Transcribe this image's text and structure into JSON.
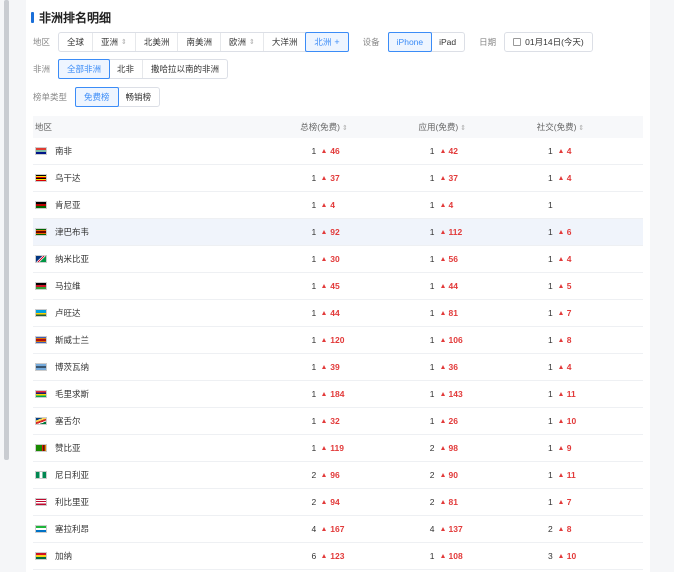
{
  "page_title": "非洲排名明细",
  "filters": {
    "region": {
      "label": "地区",
      "options": [
        "全球",
        "亚洲",
        "北美洲",
        "南美洲",
        "欧洲",
        "大洋洲",
        "北洲"
      ],
      "active": "北洲"
    },
    "device": {
      "label": "设备",
      "options": [
        "iPhone",
        "iPad"
      ],
      "active": "iPhone"
    },
    "date": {
      "label": "日期",
      "value": "01月14日(今天)"
    },
    "africa": {
      "label": "非洲",
      "options": [
        "全部非洲",
        "北非",
        "撒哈拉以南的非洲"
      ],
      "active": "全部非洲"
    },
    "list_type": {
      "label": "榜单类型",
      "options": [
        "免费榜",
        "畅销榜"
      ],
      "active": "免费榜"
    }
  },
  "table": {
    "headers": {
      "region": "地区",
      "overall": "总榜(免费)",
      "apps": "应用(免费)",
      "social": "社交(免费)"
    },
    "rows": [
      {
        "country": "南非",
        "flag": "za",
        "overall": {
          "rank": "1",
          "change": "46"
        },
        "apps": {
          "rank": "1",
          "change": "42"
        },
        "social": {
          "rank": "1",
          "change": "4"
        }
      },
      {
        "country": "乌干达",
        "flag": "ug",
        "overall": {
          "rank": "1",
          "change": "37"
        },
        "apps": {
          "rank": "1",
          "change": "37"
        },
        "social": {
          "rank": "1",
          "change": "4"
        }
      },
      {
        "country": "肯尼亚",
        "flag": "ke",
        "overall": {
          "rank": "1",
          "change": "4"
        },
        "apps": {
          "rank": "1",
          "change": "4"
        },
        "social": {
          "rank": "1",
          "change": ""
        }
      },
      {
        "country": "津巴布韦",
        "flag": "zw",
        "overall": {
          "rank": "1",
          "change": "92"
        },
        "apps": {
          "rank": "1",
          "change": "112"
        },
        "social": {
          "rank": "1",
          "change": "6"
        }
      },
      {
        "country": "纳米比亚",
        "flag": "na",
        "overall": {
          "rank": "1",
          "change": "30"
        },
        "apps": {
          "rank": "1",
          "change": "56"
        },
        "social": {
          "rank": "1",
          "change": "4"
        }
      },
      {
        "country": "马拉维",
        "flag": "mw",
        "overall": {
          "rank": "1",
          "change": "45"
        },
        "apps": {
          "rank": "1",
          "change": "44"
        },
        "social": {
          "rank": "1",
          "change": "5"
        }
      },
      {
        "country": "卢旺达",
        "flag": "rw",
        "overall": {
          "rank": "1",
          "change": "44"
        },
        "apps": {
          "rank": "1",
          "change": "81"
        },
        "social": {
          "rank": "1",
          "change": "7"
        }
      },
      {
        "country": "斯威士兰",
        "flag": "sz",
        "overall": {
          "rank": "1",
          "change": "120"
        },
        "apps": {
          "rank": "1",
          "change": "106"
        },
        "social": {
          "rank": "1",
          "change": "8"
        }
      },
      {
        "country": "博茨瓦纳",
        "flag": "bw",
        "overall": {
          "rank": "1",
          "change": "39"
        },
        "apps": {
          "rank": "1",
          "change": "36"
        },
        "social": {
          "rank": "1",
          "change": "4"
        }
      },
      {
        "country": "毛里求斯",
        "flag": "mu",
        "overall": {
          "rank": "1",
          "change": "184"
        },
        "apps": {
          "rank": "1",
          "change": "143"
        },
        "social": {
          "rank": "1",
          "change": "11"
        }
      },
      {
        "country": "塞舌尔",
        "flag": "sc",
        "overall": {
          "rank": "1",
          "change": "32"
        },
        "apps": {
          "rank": "1",
          "change": "26"
        },
        "social": {
          "rank": "1",
          "change": "10"
        }
      },
      {
        "country": "赞比亚",
        "flag": "zm",
        "overall": {
          "rank": "1",
          "change": "119"
        },
        "apps": {
          "rank": "2",
          "change": "98"
        },
        "social": {
          "rank": "1",
          "change": "9"
        }
      },
      {
        "country": "尼日利亚",
        "flag": "ng",
        "overall": {
          "rank": "2",
          "change": "96"
        },
        "apps": {
          "rank": "2",
          "change": "90"
        },
        "social": {
          "rank": "1",
          "change": "11"
        }
      },
      {
        "country": "利比里亚",
        "flag": "lr",
        "overall": {
          "rank": "2",
          "change": "94"
        },
        "apps": {
          "rank": "2",
          "change": "81"
        },
        "social": {
          "rank": "1",
          "change": "7"
        }
      },
      {
        "country": "塞拉利昂",
        "flag": "sl",
        "overall": {
          "rank": "4",
          "change": "167"
        },
        "apps": {
          "rank": "4",
          "change": "137"
        },
        "social": {
          "rank": "2",
          "change": "8"
        }
      },
      {
        "country": "加纳",
        "flag": "gh",
        "overall": {
          "rank": "6",
          "change": "123"
        },
        "apps": {
          "rank": "1",
          "change": "108"
        },
        "social": {
          "rank": "3",
          "change": "10"
        }
      }
    ],
    "highlighted_row": 3,
    "change_color": "#e23a3a",
    "accent_color": "#3b8cf7"
  }
}
